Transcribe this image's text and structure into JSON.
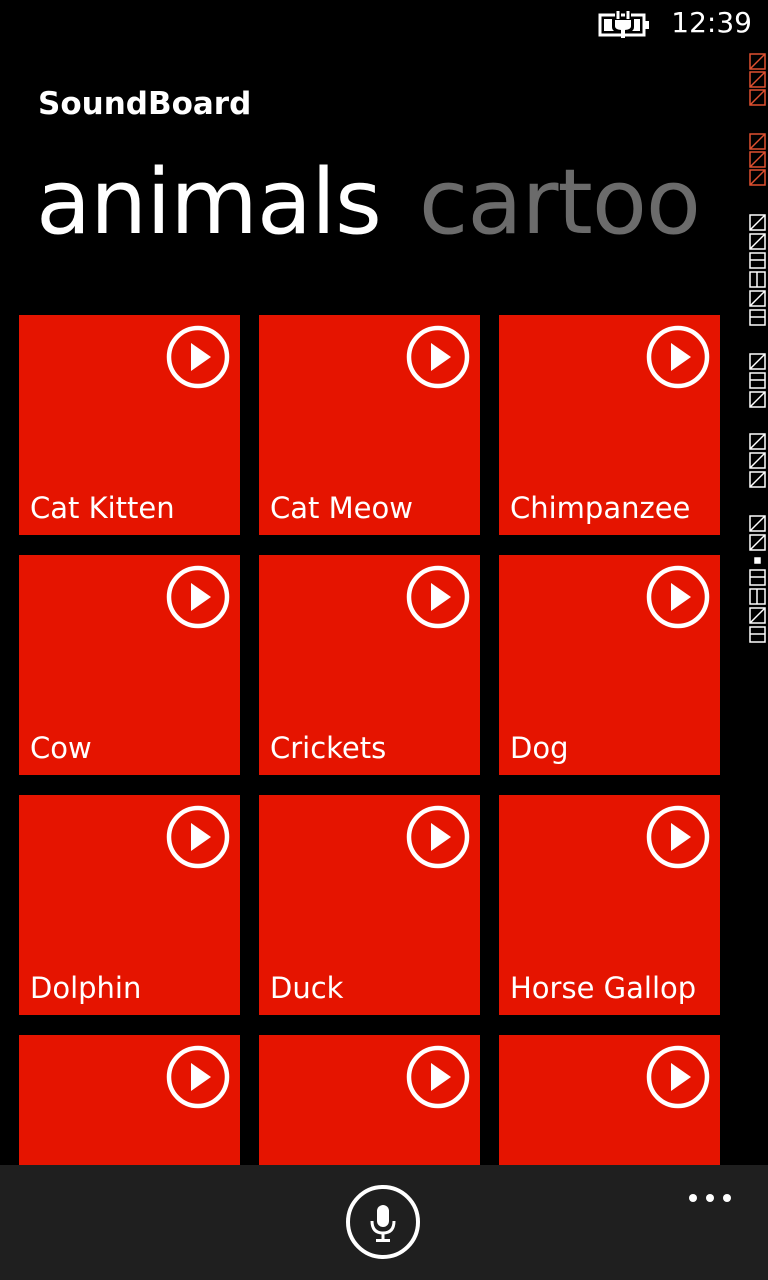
{
  "status_bar": {
    "time": "12:39",
    "battery_icon": "battery-charging-icon"
  },
  "app": {
    "title": "SoundBoard"
  },
  "pivot": {
    "active": "animals",
    "next": "cartoo"
  },
  "tiles": [
    {
      "label": "Cat Kitten"
    },
    {
      "label": "Cat Meow"
    },
    {
      "label": "Chimpanzee"
    },
    {
      "label": "Cow"
    },
    {
      "label": "Crickets"
    },
    {
      "label": "Dog"
    },
    {
      "label": "Dolphin"
    },
    {
      "label": "Duck"
    },
    {
      "label": "Horse Gallop"
    },
    {
      "label": ""
    },
    {
      "label": ""
    },
    {
      "label": ""
    }
  ],
  "app_bar": {
    "mic_icon": "microphone-icon",
    "more_icon": "ellipsis-icon"
  },
  "colors": {
    "accent": "#e51400",
    "background": "#000000",
    "app_bar": "#1f1f1f",
    "inactive_text": "#6b6b6b"
  }
}
